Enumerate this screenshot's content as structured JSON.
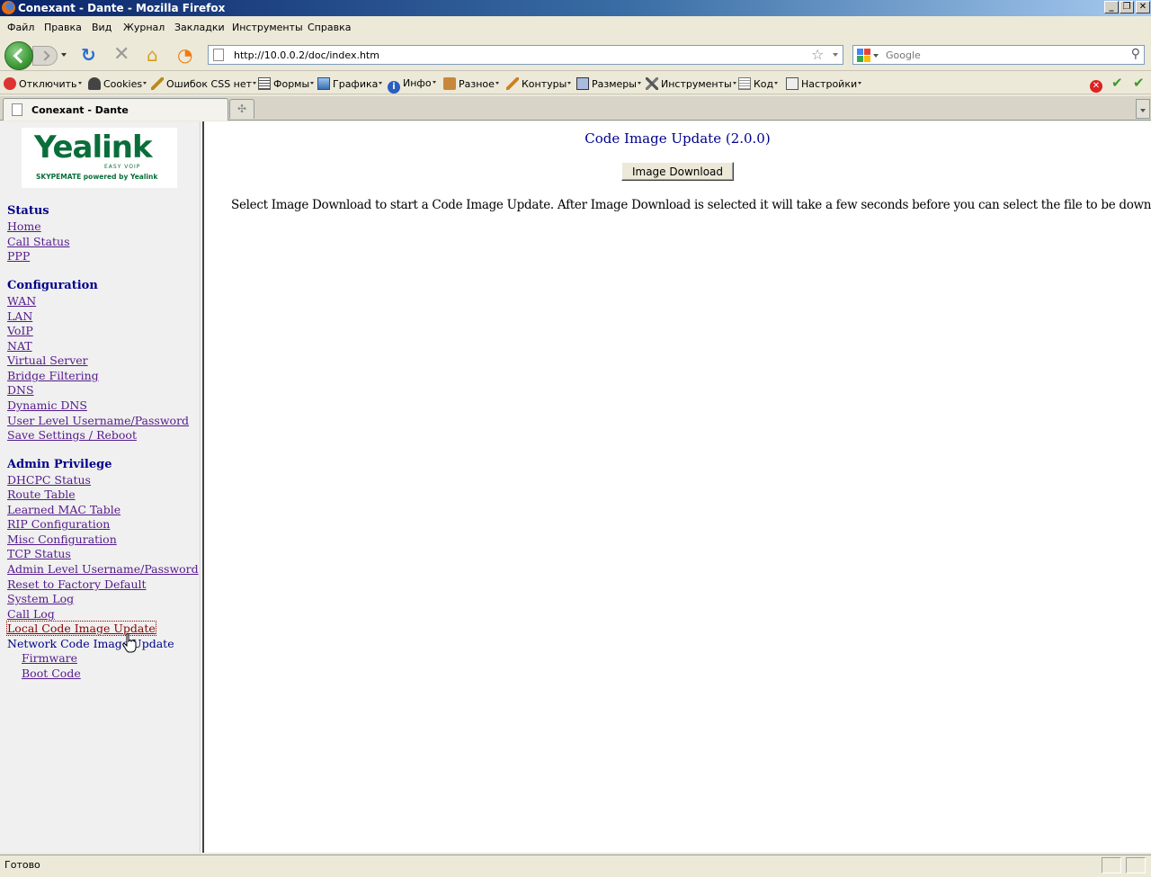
{
  "window": {
    "title": "Conexant - Dante - Mozilla Firefox",
    "controls": [
      "_",
      "❐",
      "✕"
    ]
  },
  "menu": [
    "Файл",
    "Правка",
    "Вид",
    "Журнал",
    "Закладки",
    "Инструменты",
    "Справка"
  ],
  "nav": {
    "url": "http://10.0.0.2/doc/index.htm",
    "search_placeholder": "Google"
  },
  "devbar": {
    "items": [
      "Отключить",
      "Cookies",
      "Ошибок CSS нет",
      "Формы",
      "Графика",
      "Инфо",
      "Разное",
      "Контуры",
      "Размеры",
      "Инструменты",
      "Код",
      "Настройки"
    ]
  },
  "tab": {
    "label": "Conexant - Dante"
  },
  "sidebar": {
    "logo": {
      "main": "Yealink",
      "tag": "EASY VOIP",
      "sub": "SKYPEMATE powered by Yealink"
    },
    "sections": [
      {
        "heading": "Status",
        "links": [
          "Home",
          "Call Status",
          "PPP"
        ]
      },
      {
        "heading": "Configuration",
        "links": [
          "WAN",
          "LAN",
          "VoIP",
          "NAT",
          "Virtual Server",
          "Bridge Filtering",
          "DNS",
          "Dynamic DNS",
          "User Level Username/Password",
          "Save Settings / Reboot"
        ]
      },
      {
        "heading": "Admin Privilege",
        "links": [
          "DHCPC Status",
          "Route Table",
          "Learned MAC Table",
          "RIP Configuration",
          "Misc Configuration",
          "TCP Status",
          "Admin Level Username/Password",
          "Reset to Factory Default",
          "System Log",
          "Call Log",
          "Local Code Image Update",
          "Network Code Image Update",
          "Firmware",
          "Boot Code"
        ]
      }
    ]
  },
  "main": {
    "heading": "Code Image Update (2.0.0)",
    "button_label": "Image Download",
    "info": "Select Image Download to start a Code Image Update. After Image Download is selected it will take a few seconds before you can select the file to be downloaded."
  },
  "status": {
    "text": "Готово"
  }
}
